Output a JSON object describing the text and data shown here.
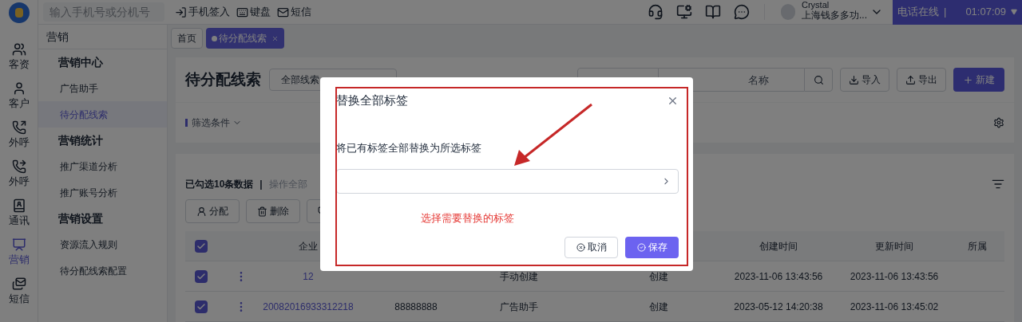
{
  "header": {
    "phone_placeholder": "输入手机号或分机号",
    "tools": [
      {
        "kind": "signin",
        "label": "手机签入"
      },
      {
        "kind": "keyboard",
        "label": "键盘"
      },
      {
        "kind": "sms",
        "label": "短信"
      }
    ],
    "user": {
      "name": "Crystal",
      "company": "上海钱多多功..."
    },
    "call_status": {
      "label": "电话在线",
      "separator": "|",
      "time": "01:07:09"
    }
  },
  "rail": [
    {
      "kind": "leads",
      "label": "客资",
      "selected": false
    },
    {
      "kind": "customer",
      "label": "客户",
      "selected": false
    },
    {
      "kind": "callout",
      "label": "外呼",
      "selected": false
    },
    {
      "kind": "callout2",
      "label": "外呼",
      "selected": false
    },
    {
      "kind": "contacts",
      "label": "通讯",
      "selected": false
    },
    {
      "kind": "marketing",
      "label": "营销",
      "selected": true
    },
    {
      "kind": "sms",
      "label": "短信",
      "selected": false
    }
  ],
  "sidebar": {
    "title": "营销",
    "groups": [
      {
        "title": "营销中心",
        "items": [
          {
            "label": "广告助手",
            "selected": false
          },
          {
            "label": "待分配线索",
            "selected": true
          }
        ]
      },
      {
        "title": "营销统计",
        "items": [
          {
            "label": "推广渠道分析",
            "selected": false
          },
          {
            "label": "推广账号分析",
            "selected": false
          }
        ]
      },
      {
        "title": "营销设置",
        "items": [
          {
            "label": "资源流入规则",
            "selected": false
          },
          {
            "label": "待分配线索配置",
            "selected": false
          }
        ]
      }
    ]
  },
  "tabs": [
    {
      "label": "首页",
      "selected": false,
      "closable": false
    },
    {
      "label": "待分配线索",
      "selected": true,
      "closable": true
    }
  ],
  "page": {
    "title": "待分配线索",
    "scope": "全部线索",
    "search_placeholder": "名称",
    "buttons": [
      {
        "kind": "import",
        "label": "导入"
      },
      {
        "kind": "export",
        "label": "导出"
      },
      {
        "kind": "new",
        "label": "新建"
      }
    ],
    "filter": "筛选条件"
  },
  "list": {
    "selection": "已勾选10条数据",
    "separator": "|",
    "select_all": "操作全部",
    "actions": [
      {
        "kind": "assign",
        "label": "分配"
      },
      {
        "kind": "delete",
        "label": "删除"
      },
      {
        "kind": "tag"
      }
    ],
    "columns": [
      "企业",
      "创建时间",
      "更新时间",
      "所属"
    ],
    "all_checked": true,
    "rows": [
      {
        "checked": true,
        "company": "12",
        "column_4": "手动创建",
        "column_5": "创建",
        "created": "2023-11-06 13:43:56",
        "updated": "2023-11-06 13:43:56"
      },
      {
        "checked": true,
        "company": "20082016933312218",
        "column_3": "88888888",
        "column_4": "广告助手",
        "column_5": "创建",
        "created": "2023-05-12 14:20:38",
        "updated": "2023-11-06 13:45:02"
      }
    ]
  },
  "dialog": {
    "title": "替换全部标签",
    "label": "将已有标签全部替换为所选标签",
    "hint": "选择需要替换的标签",
    "cancel": "取消",
    "save": "保存"
  }
}
